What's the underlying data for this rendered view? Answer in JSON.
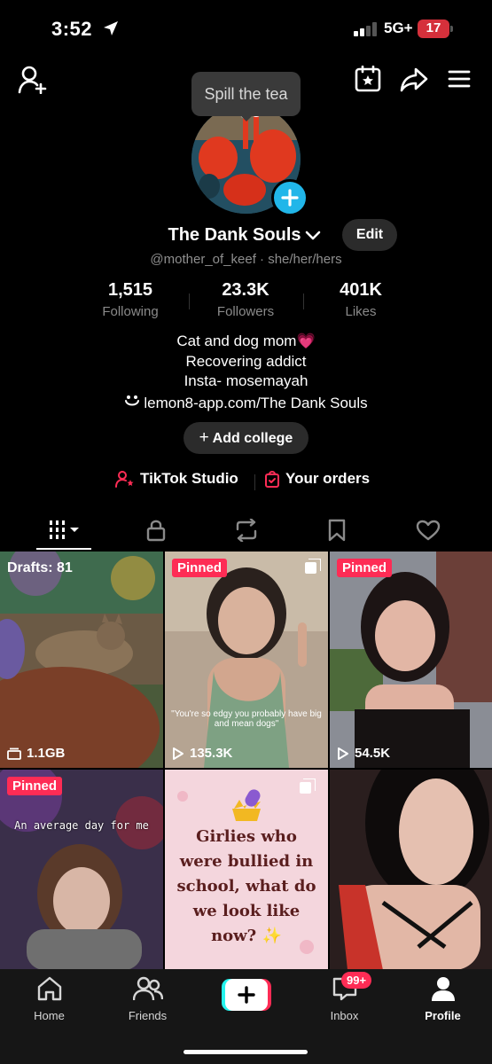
{
  "status_bar": {
    "time": "3:52",
    "network": "5G+",
    "battery": "17"
  },
  "tooltip": "Spill the tea",
  "profile": {
    "display_name": "The Dank Souls",
    "edit_label": "Edit",
    "handle": "@mother_of_keef · she/her/hers",
    "stats": [
      {
        "value": "1,515",
        "label": "Following"
      },
      {
        "value": "23.3K",
        "label": "Followers"
      },
      {
        "value": "401K",
        "label": "Likes"
      }
    ],
    "bio": [
      "Cat and dog mom💗",
      "Recovering addict",
      "Insta- mosemayah"
    ],
    "link": "lemon8-app.com/The Dank Souls",
    "add_college": "Add college",
    "tiktok_studio": "TikTok Studio",
    "your_orders": "Your orders"
  },
  "tabs": [
    "videos",
    "private",
    "reposts",
    "favorites",
    "liked"
  ],
  "grid": [
    {
      "drafts": "Drafts: 81",
      "stat": "1.1GB",
      "stat_icon": "storage-icon"
    },
    {
      "pinned": "Pinned",
      "stat": "135.3K",
      "caption": "\"You're so edgy you probably have big and mean dogs\""
    },
    {
      "pinned": "Pinned",
      "stat": "54.5K"
    },
    {
      "pinned": "Pinned",
      "overlay": "An average day for me"
    },
    {
      "text": "Girlies who were bullied in school, what do we look like now? ✨"
    },
    {}
  ],
  "bottom_nav": {
    "home": "Home",
    "friends": "Friends",
    "inbox": "Inbox",
    "inbox_badge": "99+",
    "profile": "Profile"
  },
  "colors": {
    "accent": "#fe2c55",
    "avatar_add": "#21b6e9",
    "chip_bg": "#2b2b2b"
  }
}
